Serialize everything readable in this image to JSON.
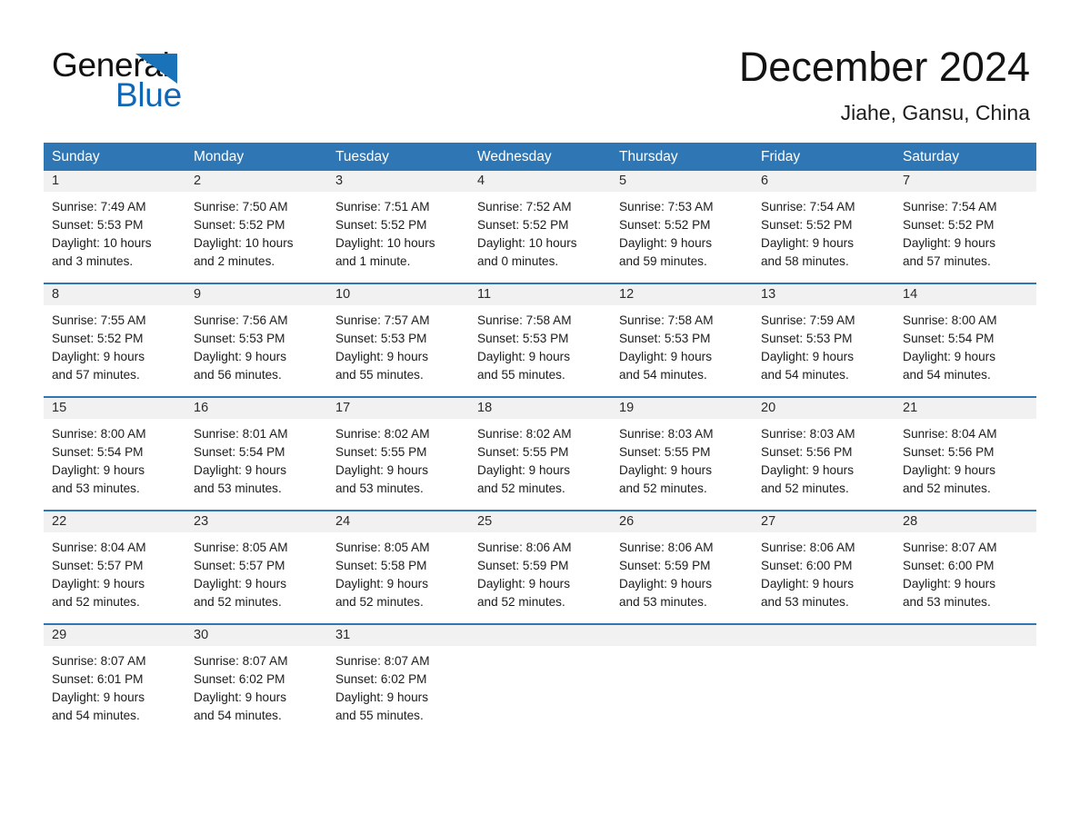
{
  "brand": {
    "name_part1": "General",
    "name_part2": "Blue",
    "triangle_color": "#1a72b8",
    "blue_text_color": "#1267b5"
  },
  "header": {
    "month_title": "December 2024",
    "location": "Jiahe, Gansu, China"
  },
  "theme": {
    "header_row_bg": "#2f76b4",
    "date_band_bg": "#f1f1f1",
    "week_top_border": "#2f76b4",
    "page_bg": "#ffffff"
  },
  "weekdays": [
    "Sunday",
    "Monday",
    "Tuesday",
    "Wednesday",
    "Thursday",
    "Friday",
    "Saturday"
  ],
  "weeks": [
    [
      {
        "date": "1",
        "sunrise": "Sunrise: 7:49 AM",
        "sunset": "Sunset: 5:53 PM",
        "daylight_1": "Daylight: 10 hours",
        "daylight_2": "and 3 minutes."
      },
      {
        "date": "2",
        "sunrise": "Sunrise: 7:50 AM",
        "sunset": "Sunset: 5:52 PM",
        "daylight_1": "Daylight: 10 hours",
        "daylight_2": "and 2 minutes."
      },
      {
        "date": "3",
        "sunrise": "Sunrise: 7:51 AM",
        "sunset": "Sunset: 5:52 PM",
        "daylight_1": "Daylight: 10 hours",
        "daylight_2": "and 1 minute."
      },
      {
        "date": "4",
        "sunrise": "Sunrise: 7:52 AM",
        "sunset": "Sunset: 5:52 PM",
        "daylight_1": "Daylight: 10 hours",
        "daylight_2": "and 0 minutes."
      },
      {
        "date": "5",
        "sunrise": "Sunrise: 7:53 AM",
        "sunset": "Sunset: 5:52 PM",
        "daylight_1": "Daylight: 9 hours",
        "daylight_2": "and 59 minutes."
      },
      {
        "date": "6",
        "sunrise": "Sunrise: 7:54 AM",
        "sunset": "Sunset: 5:52 PM",
        "daylight_1": "Daylight: 9 hours",
        "daylight_2": "and 58 minutes."
      },
      {
        "date": "7",
        "sunrise": "Sunrise: 7:54 AM",
        "sunset": "Sunset: 5:52 PM",
        "daylight_1": "Daylight: 9 hours",
        "daylight_2": "and 57 minutes."
      }
    ],
    [
      {
        "date": "8",
        "sunrise": "Sunrise: 7:55 AM",
        "sunset": "Sunset: 5:52 PM",
        "daylight_1": "Daylight: 9 hours",
        "daylight_2": "and 57 minutes."
      },
      {
        "date": "9",
        "sunrise": "Sunrise: 7:56 AM",
        "sunset": "Sunset: 5:53 PM",
        "daylight_1": "Daylight: 9 hours",
        "daylight_2": "and 56 minutes."
      },
      {
        "date": "10",
        "sunrise": "Sunrise: 7:57 AM",
        "sunset": "Sunset: 5:53 PM",
        "daylight_1": "Daylight: 9 hours",
        "daylight_2": "and 55 minutes."
      },
      {
        "date": "11",
        "sunrise": "Sunrise: 7:58 AM",
        "sunset": "Sunset: 5:53 PM",
        "daylight_1": "Daylight: 9 hours",
        "daylight_2": "and 55 minutes."
      },
      {
        "date": "12",
        "sunrise": "Sunrise: 7:58 AM",
        "sunset": "Sunset: 5:53 PM",
        "daylight_1": "Daylight: 9 hours",
        "daylight_2": "and 54 minutes."
      },
      {
        "date": "13",
        "sunrise": "Sunrise: 7:59 AM",
        "sunset": "Sunset: 5:53 PM",
        "daylight_1": "Daylight: 9 hours",
        "daylight_2": "and 54 minutes."
      },
      {
        "date": "14",
        "sunrise": "Sunrise: 8:00 AM",
        "sunset": "Sunset: 5:54 PM",
        "daylight_1": "Daylight: 9 hours",
        "daylight_2": "and 54 minutes."
      }
    ],
    [
      {
        "date": "15",
        "sunrise": "Sunrise: 8:00 AM",
        "sunset": "Sunset: 5:54 PM",
        "daylight_1": "Daylight: 9 hours",
        "daylight_2": "and 53 minutes."
      },
      {
        "date": "16",
        "sunrise": "Sunrise: 8:01 AM",
        "sunset": "Sunset: 5:54 PM",
        "daylight_1": "Daylight: 9 hours",
        "daylight_2": "and 53 minutes."
      },
      {
        "date": "17",
        "sunrise": "Sunrise: 8:02 AM",
        "sunset": "Sunset: 5:55 PM",
        "daylight_1": "Daylight: 9 hours",
        "daylight_2": "and 53 minutes."
      },
      {
        "date": "18",
        "sunrise": "Sunrise: 8:02 AM",
        "sunset": "Sunset: 5:55 PM",
        "daylight_1": "Daylight: 9 hours",
        "daylight_2": "and 52 minutes."
      },
      {
        "date": "19",
        "sunrise": "Sunrise: 8:03 AM",
        "sunset": "Sunset: 5:55 PM",
        "daylight_1": "Daylight: 9 hours",
        "daylight_2": "and 52 minutes."
      },
      {
        "date": "20",
        "sunrise": "Sunrise: 8:03 AM",
        "sunset": "Sunset: 5:56 PM",
        "daylight_1": "Daylight: 9 hours",
        "daylight_2": "and 52 minutes."
      },
      {
        "date": "21",
        "sunrise": "Sunrise: 8:04 AM",
        "sunset": "Sunset: 5:56 PM",
        "daylight_1": "Daylight: 9 hours",
        "daylight_2": "and 52 minutes."
      }
    ],
    [
      {
        "date": "22",
        "sunrise": "Sunrise: 8:04 AM",
        "sunset": "Sunset: 5:57 PM",
        "daylight_1": "Daylight: 9 hours",
        "daylight_2": "and 52 minutes."
      },
      {
        "date": "23",
        "sunrise": "Sunrise: 8:05 AM",
        "sunset": "Sunset: 5:57 PM",
        "daylight_1": "Daylight: 9 hours",
        "daylight_2": "and 52 minutes."
      },
      {
        "date": "24",
        "sunrise": "Sunrise: 8:05 AM",
        "sunset": "Sunset: 5:58 PM",
        "daylight_1": "Daylight: 9 hours",
        "daylight_2": "and 52 minutes."
      },
      {
        "date": "25",
        "sunrise": "Sunrise: 8:06 AM",
        "sunset": "Sunset: 5:59 PM",
        "daylight_1": "Daylight: 9 hours",
        "daylight_2": "and 52 minutes."
      },
      {
        "date": "26",
        "sunrise": "Sunrise: 8:06 AM",
        "sunset": "Sunset: 5:59 PM",
        "daylight_1": "Daylight: 9 hours",
        "daylight_2": "and 53 minutes."
      },
      {
        "date": "27",
        "sunrise": "Sunrise: 8:06 AM",
        "sunset": "Sunset: 6:00 PM",
        "daylight_1": "Daylight: 9 hours",
        "daylight_2": "and 53 minutes."
      },
      {
        "date": "28",
        "sunrise": "Sunrise: 8:07 AM",
        "sunset": "Sunset: 6:00 PM",
        "daylight_1": "Daylight: 9 hours",
        "daylight_2": "and 53 minutes."
      }
    ],
    [
      {
        "date": "29",
        "sunrise": "Sunrise: 8:07 AM",
        "sunset": "Sunset: 6:01 PM",
        "daylight_1": "Daylight: 9 hours",
        "daylight_2": "and 54 minutes."
      },
      {
        "date": "30",
        "sunrise": "Sunrise: 8:07 AM",
        "sunset": "Sunset: 6:02 PM",
        "daylight_1": "Daylight: 9 hours",
        "daylight_2": "and 54 minutes."
      },
      {
        "date": "31",
        "sunrise": "Sunrise: 8:07 AM",
        "sunset": "Sunset: 6:02 PM",
        "daylight_1": "Daylight: 9 hours",
        "daylight_2": "and 55 minutes."
      },
      {
        "date": "",
        "sunrise": "",
        "sunset": "",
        "daylight_1": "",
        "daylight_2": ""
      },
      {
        "date": "",
        "sunrise": "",
        "sunset": "",
        "daylight_1": "",
        "daylight_2": ""
      },
      {
        "date": "",
        "sunrise": "",
        "sunset": "",
        "daylight_1": "",
        "daylight_2": ""
      },
      {
        "date": "",
        "sunrise": "",
        "sunset": "",
        "daylight_1": "",
        "daylight_2": ""
      }
    ]
  ]
}
